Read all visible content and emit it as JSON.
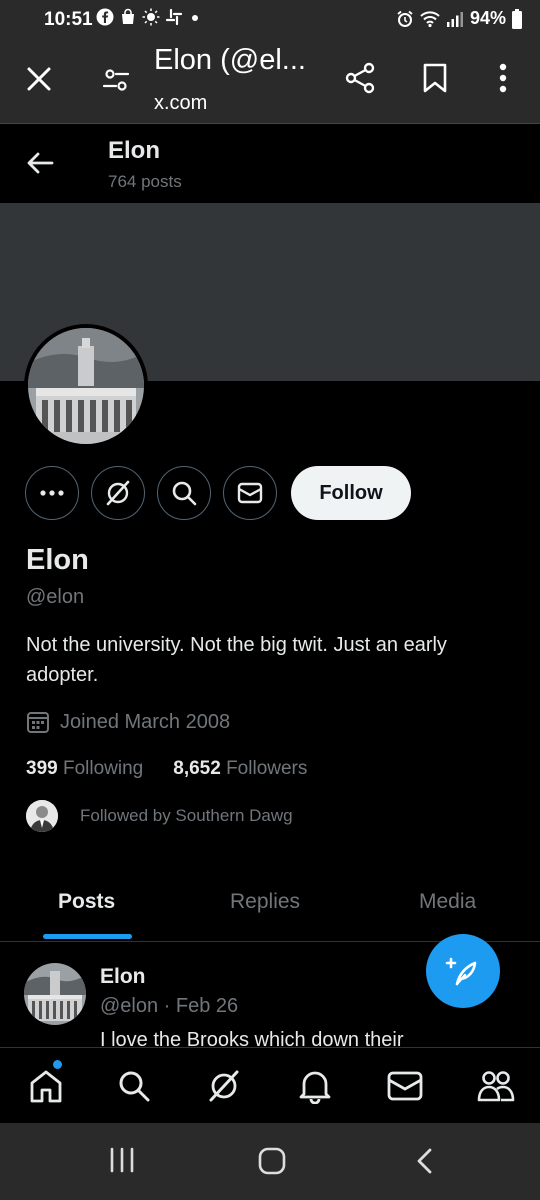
{
  "status_bar": {
    "time": "10:51",
    "battery": "94%"
  },
  "browser": {
    "title": "Elon (@el...",
    "url": "x.com"
  },
  "profile_header": {
    "name": "Elon",
    "posts_count": "764 posts"
  },
  "profile": {
    "display_name": "Elon",
    "handle": "@elon",
    "bio": "Not the university. Not the big twit. Just an early adopter.",
    "joined": "Joined March 2008",
    "following_count": "399",
    "following_label": "Following",
    "followers_count": "8,652",
    "followers_label": "Followers",
    "followed_by": "Followed by Southern Dawg",
    "follow_button": "Follow"
  },
  "tabs": [
    {
      "label": "Posts",
      "active": true
    },
    {
      "label": "Replies",
      "active": false
    },
    {
      "label": "Media",
      "active": false
    }
  ],
  "post": {
    "name": "Elon",
    "meta": "@elon · Feb 26",
    "text": "I love the Brooks which down their"
  },
  "icons": {
    "browser": [
      "close-icon",
      "site-settings-icon",
      "share-icon",
      "bookmark-icon",
      "more-vertical-icon"
    ],
    "actions": [
      "more-icon",
      "grok-icon",
      "search-icon",
      "mail-icon"
    ],
    "bottom_nav": [
      "home-icon",
      "search-icon",
      "grok-icon",
      "notifications-icon",
      "messages-icon",
      "communities-icon"
    ],
    "android_nav": [
      "recents-icon",
      "home-icon",
      "back-icon"
    ]
  },
  "colors": {
    "accent": "#1d9bf0",
    "muted": "#71767b",
    "banner": "#333639"
  }
}
